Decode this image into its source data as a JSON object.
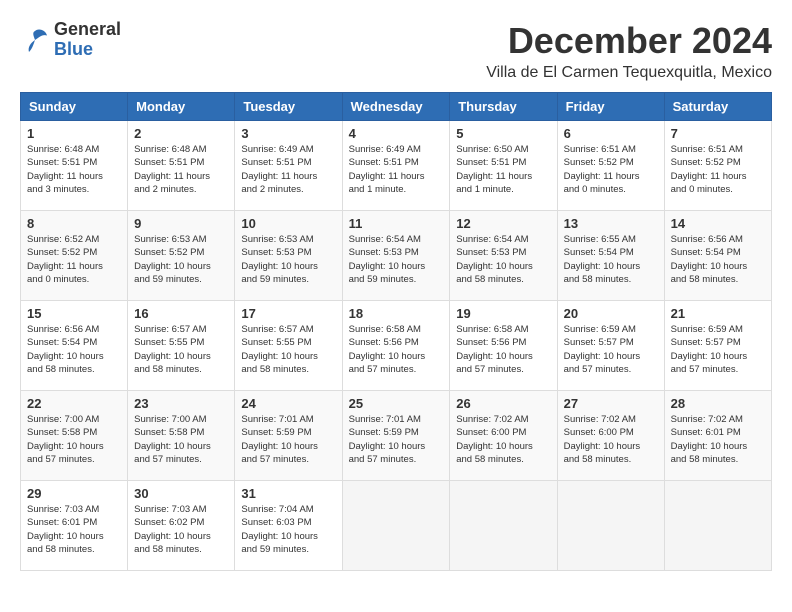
{
  "logo": {
    "general": "General",
    "blue": "Blue"
  },
  "title": {
    "month": "December 2024",
    "location": "Villa de El Carmen Tequexquitla, Mexico"
  },
  "headers": [
    "Sunday",
    "Monday",
    "Tuesday",
    "Wednesday",
    "Thursday",
    "Friday",
    "Saturday"
  ],
  "weeks": [
    [
      {
        "day": "1",
        "info": "Sunrise: 6:48 AM\nSunset: 5:51 PM\nDaylight: 11 hours\nand 3 minutes."
      },
      {
        "day": "2",
        "info": "Sunrise: 6:48 AM\nSunset: 5:51 PM\nDaylight: 11 hours\nand 2 minutes."
      },
      {
        "day": "3",
        "info": "Sunrise: 6:49 AM\nSunset: 5:51 PM\nDaylight: 11 hours\nand 2 minutes."
      },
      {
        "day": "4",
        "info": "Sunrise: 6:49 AM\nSunset: 5:51 PM\nDaylight: 11 hours\nand 1 minute."
      },
      {
        "day": "5",
        "info": "Sunrise: 6:50 AM\nSunset: 5:51 PM\nDaylight: 11 hours\nand 1 minute."
      },
      {
        "day": "6",
        "info": "Sunrise: 6:51 AM\nSunset: 5:52 PM\nDaylight: 11 hours\nand 0 minutes."
      },
      {
        "day": "7",
        "info": "Sunrise: 6:51 AM\nSunset: 5:52 PM\nDaylight: 11 hours\nand 0 minutes."
      }
    ],
    [
      {
        "day": "8",
        "info": "Sunrise: 6:52 AM\nSunset: 5:52 PM\nDaylight: 11 hours\nand 0 minutes."
      },
      {
        "day": "9",
        "info": "Sunrise: 6:53 AM\nSunset: 5:52 PM\nDaylight: 10 hours\nand 59 minutes."
      },
      {
        "day": "10",
        "info": "Sunrise: 6:53 AM\nSunset: 5:53 PM\nDaylight: 10 hours\nand 59 minutes."
      },
      {
        "day": "11",
        "info": "Sunrise: 6:54 AM\nSunset: 5:53 PM\nDaylight: 10 hours\nand 59 minutes."
      },
      {
        "day": "12",
        "info": "Sunrise: 6:54 AM\nSunset: 5:53 PM\nDaylight: 10 hours\nand 58 minutes."
      },
      {
        "day": "13",
        "info": "Sunrise: 6:55 AM\nSunset: 5:54 PM\nDaylight: 10 hours\nand 58 minutes."
      },
      {
        "day": "14",
        "info": "Sunrise: 6:56 AM\nSunset: 5:54 PM\nDaylight: 10 hours\nand 58 minutes."
      }
    ],
    [
      {
        "day": "15",
        "info": "Sunrise: 6:56 AM\nSunset: 5:54 PM\nDaylight: 10 hours\nand 58 minutes."
      },
      {
        "day": "16",
        "info": "Sunrise: 6:57 AM\nSunset: 5:55 PM\nDaylight: 10 hours\nand 58 minutes."
      },
      {
        "day": "17",
        "info": "Sunrise: 6:57 AM\nSunset: 5:55 PM\nDaylight: 10 hours\nand 58 minutes."
      },
      {
        "day": "18",
        "info": "Sunrise: 6:58 AM\nSunset: 5:56 PM\nDaylight: 10 hours\nand 57 minutes."
      },
      {
        "day": "19",
        "info": "Sunrise: 6:58 AM\nSunset: 5:56 PM\nDaylight: 10 hours\nand 57 minutes."
      },
      {
        "day": "20",
        "info": "Sunrise: 6:59 AM\nSunset: 5:57 PM\nDaylight: 10 hours\nand 57 minutes."
      },
      {
        "day": "21",
        "info": "Sunrise: 6:59 AM\nSunset: 5:57 PM\nDaylight: 10 hours\nand 57 minutes."
      }
    ],
    [
      {
        "day": "22",
        "info": "Sunrise: 7:00 AM\nSunset: 5:58 PM\nDaylight: 10 hours\nand 57 minutes."
      },
      {
        "day": "23",
        "info": "Sunrise: 7:00 AM\nSunset: 5:58 PM\nDaylight: 10 hours\nand 57 minutes."
      },
      {
        "day": "24",
        "info": "Sunrise: 7:01 AM\nSunset: 5:59 PM\nDaylight: 10 hours\nand 57 minutes."
      },
      {
        "day": "25",
        "info": "Sunrise: 7:01 AM\nSunset: 5:59 PM\nDaylight: 10 hours\nand 57 minutes."
      },
      {
        "day": "26",
        "info": "Sunrise: 7:02 AM\nSunset: 6:00 PM\nDaylight: 10 hours\nand 58 minutes."
      },
      {
        "day": "27",
        "info": "Sunrise: 7:02 AM\nSunset: 6:00 PM\nDaylight: 10 hours\nand 58 minutes."
      },
      {
        "day": "28",
        "info": "Sunrise: 7:02 AM\nSunset: 6:01 PM\nDaylight: 10 hours\nand 58 minutes."
      }
    ],
    [
      {
        "day": "29",
        "info": "Sunrise: 7:03 AM\nSunset: 6:01 PM\nDaylight: 10 hours\nand 58 minutes."
      },
      {
        "day": "30",
        "info": "Sunrise: 7:03 AM\nSunset: 6:02 PM\nDaylight: 10 hours\nand 58 minutes."
      },
      {
        "day": "31",
        "info": "Sunrise: 7:04 AM\nSunset: 6:03 PM\nDaylight: 10 hours\nand 59 minutes."
      },
      null,
      null,
      null,
      null
    ]
  ]
}
